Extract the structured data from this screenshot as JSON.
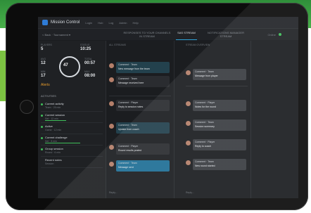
{
  "app": {
    "name": "Mission Control",
    "links": [
      "Login",
      "Hub",
      "Log",
      "Admin",
      "Help"
    ]
  },
  "subbar": {
    "back_label": "< Back · Tournament ▾",
    "tabs": [
      {
        "label": "RESPONSES TO YOUR CHANNELS IN STREAM",
        "active": false
      },
      {
        "label": "SAS STREAM",
        "active": true
      },
      {
        "label": "NOTIFICATIONS MANAGER STREAM",
        "active": false
      }
    ],
    "status": "Online"
  },
  "left_panel": {
    "stats": [
      {
        "label": "PLAYERS",
        "value": "5"
      },
      {
        "label": "STATUS",
        "value": "10:25"
      },
      {
        "label": "AVG",
        "value": "12"
      },
      {
        "label": "TOTAL",
        "value": "00:57"
      },
      {
        "label": "MIN",
        "value": "17"
      },
      {
        "label": "MAX",
        "value": "08:00"
      }
    ],
    "ring_value": "47",
    "alert": "Alerts",
    "section_title": "ACTIVITIES",
    "rows": [
      {
        "title": "Current activity",
        "sub": "Team · 25 min"
      },
      {
        "title": "Current session",
        "sub": "Set · 12 min"
      },
      {
        "title": "Active",
        "sub": "Game · 12 min"
      },
      {
        "title": "Current challenge",
        "sub": "Set · 8 min"
      },
      {
        "title": "Group session",
        "sub": "Round · 6 min"
      },
      {
        "title": "Recent notes",
        "sub": "Session"
      }
    ]
  },
  "columns": [
    {
      "head": "ALL STREAMS",
      "messages": [
        {
          "name": "Comment · Team",
          "body": "New message from the team",
          "style": "teal"
        },
        {
          "name": "Comment · Team",
          "body": "Message received here",
          "style": "dark"
        },
        {
          "name": "Comment · Player",
          "body": "Reply to session notes",
          "style": "dark"
        },
        {
          "name": "Comment · Team",
          "body": "Update from coach",
          "style": "teal"
        },
        {
          "name": "Comment · Player",
          "body": "Round results posted",
          "style": "dark"
        },
        {
          "name": "Comment · Team",
          "body": "Message sent",
          "style": "blue"
        }
      ],
      "foot": "Reply..."
    },
    {
      "head": "STREAM OVERVIEW",
      "messages": [
        {
          "name": "Comment · Team",
          "body": "Message from player",
          "style": "gray"
        },
        {
          "name": "Comment · Player",
          "body": "Notes for the round",
          "style": "gray"
        },
        {
          "name": "Comment · Team",
          "body": "Session summary",
          "style": "gray"
        },
        {
          "name": "Comment · Player",
          "body": "Reply to coach",
          "style": "gray"
        },
        {
          "name": "Comment · Team",
          "body": "New round started",
          "style": "gray"
        }
      ],
      "foot": "Reply..."
    }
  ],
  "colors": {
    "accent": "#2ea3d8",
    "status": "#3fbf5a",
    "alert": "#e49a2c"
  }
}
